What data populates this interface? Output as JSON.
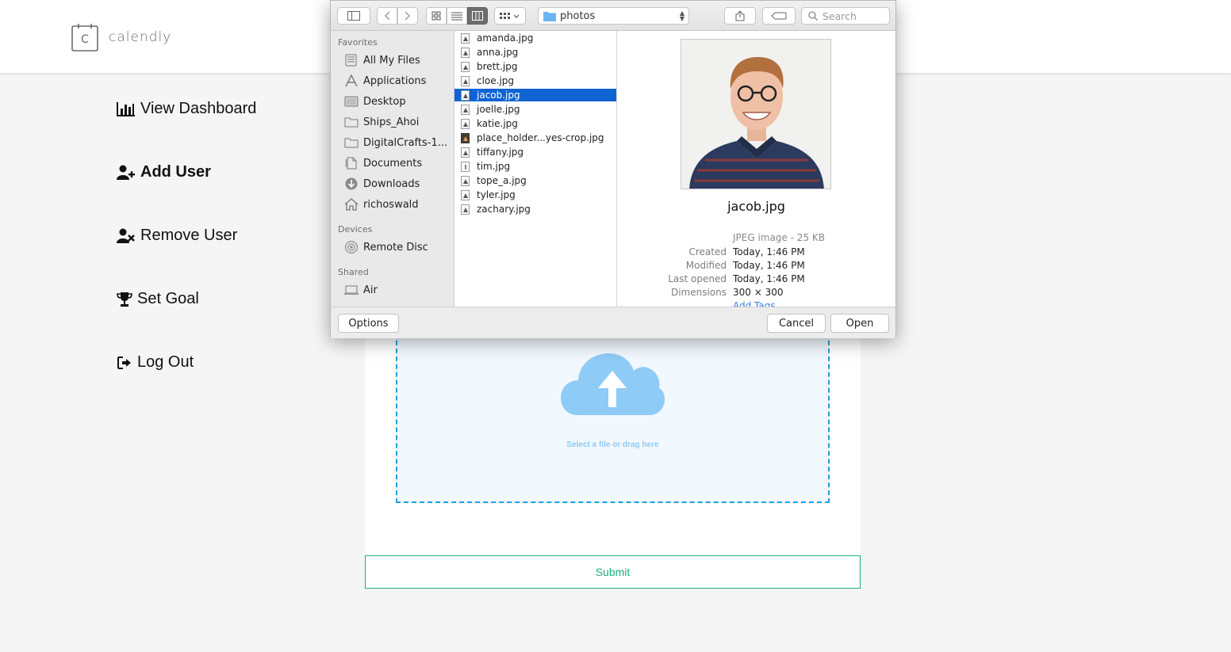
{
  "app": {
    "brand_letter": "C",
    "brand_name": "calendly"
  },
  "nav": [
    {
      "label": "View Dashboard",
      "icon": "bar-chart-icon"
    },
    {
      "label": "Add User",
      "icon": "user-plus-icon"
    },
    {
      "label": "Remove User",
      "icon": "user-times-icon"
    },
    {
      "label": "Set Goal",
      "icon": "trophy-icon"
    },
    {
      "label": "Log Out",
      "icon": "sign-out-icon"
    }
  ],
  "upload": {
    "drop_text": "Select a file or drag here",
    "submit_label": "Submit",
    "accent_color": "#1e9fe0",
    "submit_color": "#18b27a"
  },
  "dialog": {
    "path": "photos",
    "search_placeholder": "Search",
    "sidebar": {
      "favorites_heading": "Favorites",
      "favorites": [
        {
          "label": "All My Files",
          "icon": "all-files-icon"
        },
        {
          "label": "Applications",
          "icon": "applications-icon"
        },
        {
          "label": "Desktop",
          "icon": "desktop-icon"
        },
        {
          "label": "Ships_Ahoi",
          "icon": "folder-icon"
        },
        {
          "label": "DigitalCrafts-1...",
          "icon": "folder-icon"
        },
        {
          "label": "Documents",
          "icon": "documents-icon"
        },
        {
          "label": "Downloads",
          "icon": "downloads-icon"
        },
        {
          "label": "richoswald",
          "icon": "home-icon"
        }
      ],
      "devices_heading": "Devices",
      "devices": [
        {
          "label": "Remote Disc",
          "icon": "disc-icon"
        }
      ],
      "shared_heading": "Shared",
      "shared": [
        {
          "label": "Air",
          "icon": "computer-icon"
        }
      ]
    },
    "files": [
      "amanda.jpg",
      "anna.jpg",
      "brett.jpg",
      "cloe.jpg",
      "jacob.jpg",
      "joelle.jpg",
      "katie.jpg",
      "place_holder...yes-crop.jpg",
      "tiffany.jpg",
      "tim.jpg",
      "tope_a.jpg",
      "tyler.jpg",
      "zachary.jpg"
    ],
    "selected_file": "jacob.jpg",
    "preview": {
      "name": "jacob.jpg",
      "kind": "JPEG image - 25 KB",
      "created_label": "Created",
      "created": "Today, 1:46 PM",
      "modified_label": "Modified",
      "modified": "Today, 1:46 PM",
      "opened_label": "Last opened",
      "opened": "Today, 1:46 PM",
      "dimensions_label": "Dimensions",
      "dimensions": "300 × 300",
      "add_tags": "Add Tags..."
    },
    "options_label": "Options",
    "cancel_label": "Cancel",
    "open_label": "Open"
  }
}
